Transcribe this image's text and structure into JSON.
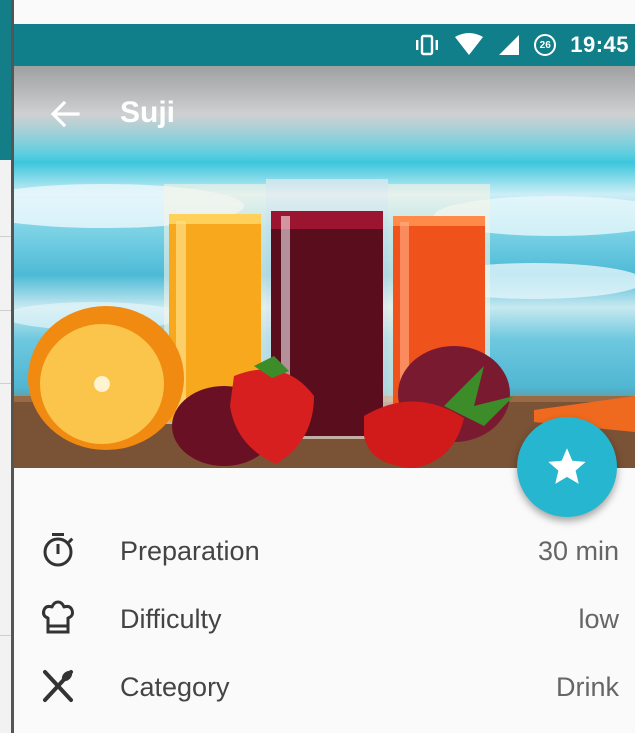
{
  "status_bar": {
    "time": "19:45",
    "notification_badge": "26",
    "icons": [
      "vibrate-icon",
      "wifi-icon",
      "signal-icon",
      "badge-icon"
    ]
  },
  "header": {
    "title": "Suji",
    "back_icon": "arrow-left-icon"
  },
  "hero": {
    "image": "juice-glasses-with-fruit-photo"
  },
  "fab": {
    "icon": "star-icon",
    "color": "#27b6cf"
  },
  "details": {
    "items": [
      {
        "icon": "stopwatch-icon",
        "label": "Preparation",
        "value": "30 min"
      },
      {
        "icon": "chef-hat-icon",
        "label": "Difficulty",
        "value": "low"
      },
      {
        "icon": "utensils-icon",
        "label": "Category",
        "value": "Drink"
      }
    ]
  },
  "colors": {
    "status_bar": "#117f89",
    "accent": "#27b6cf",
    "text_primary": "#444444",
    "text_secondary": "#666666"
  }
}
